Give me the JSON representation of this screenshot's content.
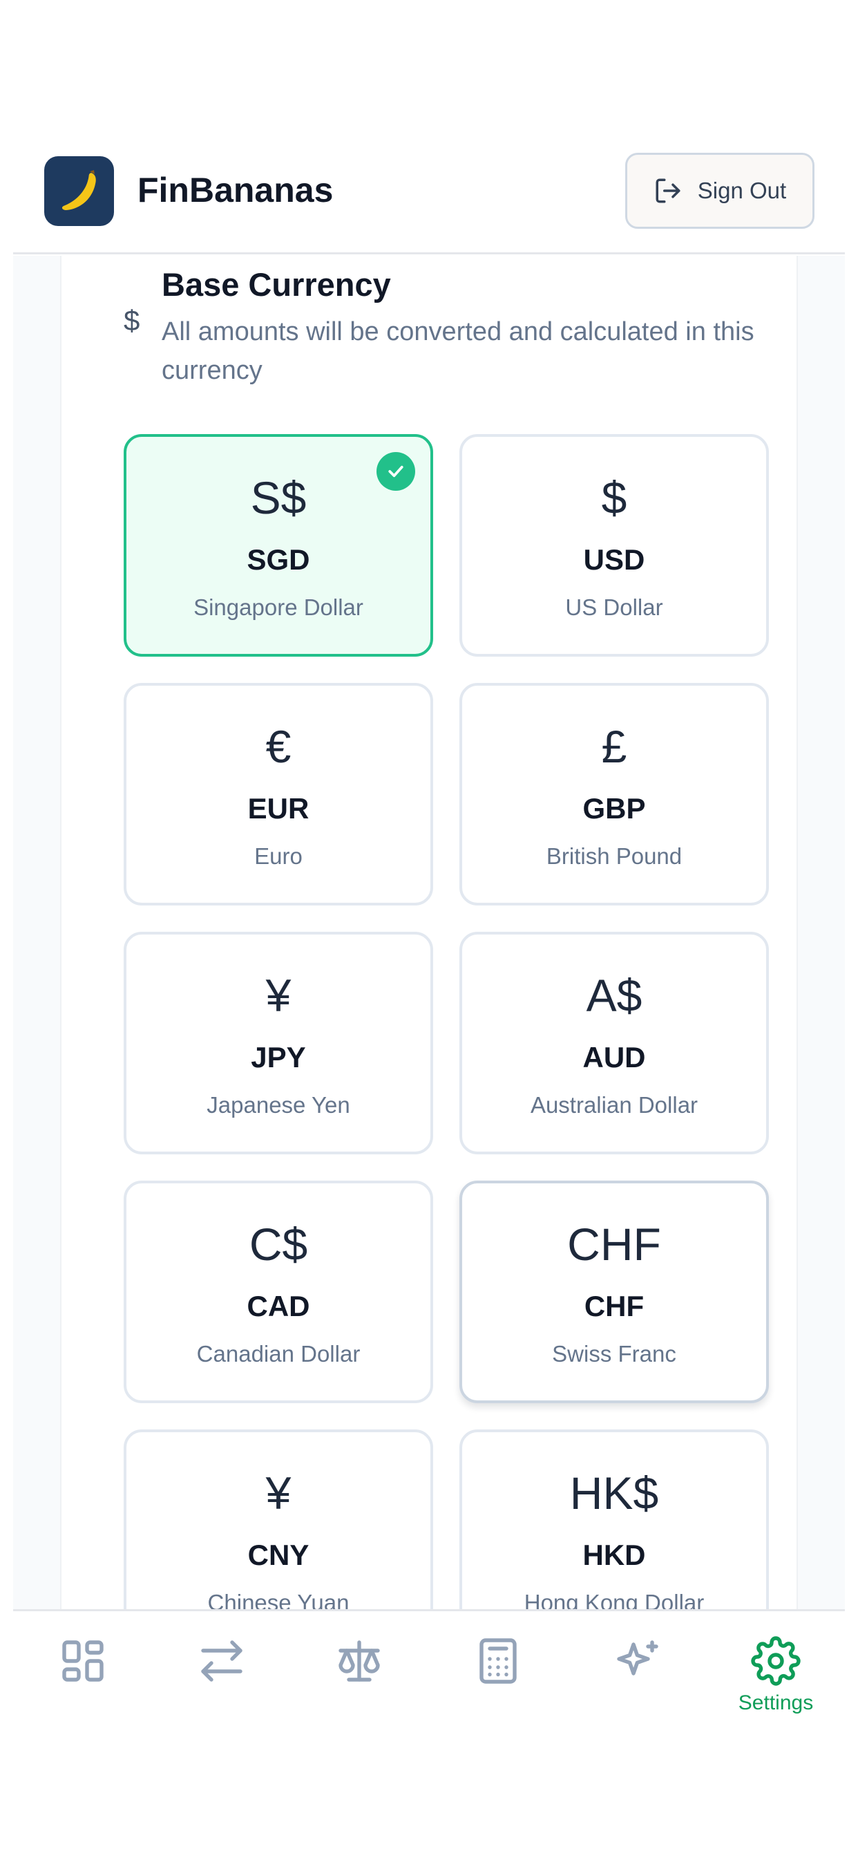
{
  "header": {
    "app_title": "FinBananas",
    "signout_label": "Sign Out",
    "logo_icon": "banana-icon"
  },
  "section": {
    "icon": "dollar-icon",
    "icon_glyph": "$",
    "title": "Base Currency",
    "description": "All amounts will be converted and calculated in this currency"
  },
  "currencies": [
    {
      "symbol": "S$",
      "code": "SGD",
      "name": "Singapore Dollar",
      "selected": true
    },
    {
      "symbol": "$",
      "code": "USD",
      "name": "US Dollar",
      "selected": false
    },
    {
      "symbol": "€",
      "code": "EUR",
      "name": "Euro",
      "selected": false
    },
    {
      "symbol": "£",
      "code": "GBP",
      "name": "British Pound",
      "selected": false
    },
    {
      "symbol": "¥",
      "code": "JPY",
      "name": "Japanese Yen",
      "selected": false
    },
    {
      "symbol": "A$",
      "code": "AUD",
      "name": "Australian Dollar",
      "selected": false
    },
    {
      "symbol": "C$",
      "code": "CAD",
      "name": "Canadian Dollar",
      "selected": false
    },
    {
      "symbol": "CHF",
      "code": "CHF",
      "name": "Swiss Franc",
      "selected": false
    },
    {
      "symbol": "¥",
      "code": "CNY",
      "name": "Chinese Yuan",
      "selected": false
    },
    {
      "symbol": "HK$",
      "code": "HKD",
      "name": "Hong Kong Dollar",
      "selected": false
    }
  ],
  "nav": {
    "items": [
      {
        "icon": "dashboard-icon",
        "label": ""
      },
      {
        "icon": "transfer-icon",
        "label": ""
      },
      {
        "icon": "balance-scale-icon",
        "label": ""
      },
      {
        "icon": "calculator-icon",
        "label": ""
      },
      {
        "icon": "sparkles-icon",
        "label": ""
      },
      {
        "icon": "gear-icon",
        "label": "Settings",
        "active": true
      }
    ]
  },
  "colors": {
    "accent": "#22c08a",
    "nav_active": "#0f9d58",
    "logo_bg": "#1e3a5f"
  }
}
